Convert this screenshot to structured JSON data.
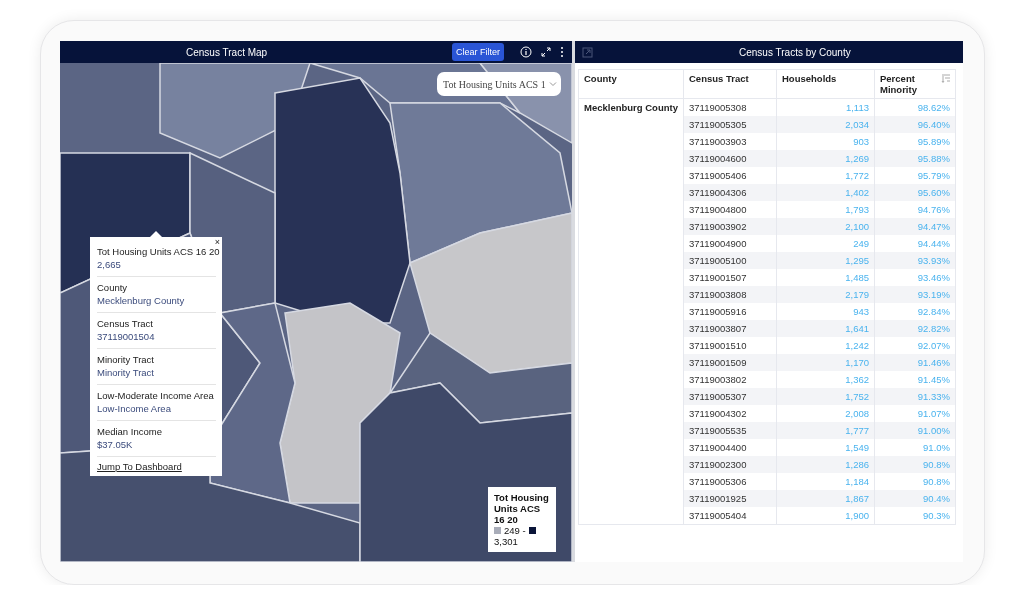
{
  "map_panel": {
    "title": "Census Tract Map",
    "clear_filter": "Clear Filter",
    "layer_select": {
      "value": "Tot Housing Units ACS 1"
    },
    "popup": {
      "close": "×",
      "fields": [
        {
          "label": "Tot Housing Units ACS 16 20",
          "value": "2,665"
        },
        {
          "label": "County",
          "value": "Mecklenburg County"
        },
        {
          "label": "Census Tract",
          "value": "37119001504"
        },
        {
          "label": "Minority Tract",
          "value": "Minority Tract"
        },
        {
          "label": "Low-Moderate Income Area",
          "value": "Low-Income Area"
        },
        {
          "label": "Median Income",
          "value": "$37.05K"
        }
      ],
      "link": "Jump To Dashboard"
    },
    "legend": {
      "title": "Tot Housing Units ACS 16 20",
      "min": "249 -",
      "max": "3,301"
    }
  },
  "table_panel": {
    "title": "Census Tracts by County",
    "columns": [
      "County",
      "Census Tract",
      "Households",
      "Percent Minority"
    ],
    "county": "Mecklenburg County",
    "rows": [
      {
        "tract": "37119005308",
        "households": "1,113",
        "percent": "98.62%"
      },
      {
        "tract": "37119005305",
        "households": "2,034",
        "percent": "96.40%"
      },
      {
        "tract": "37119003903",
        "households": "903",
        "percent": "95.89%"
      },
      {
        "tract": "37119004600",
        "households": "1,269",
        "percent": "95.88%"
      },
      {
        "tract": "37119005406",
        "households": "1,772",
        "percent": "95.79%"
      },
      {
        "tract": "37119004306",
        "households": "1,402",
        "percent": "95.60%"
      },
      {
        "tract": "37119004800",
        "households": "1,793",
        "percent": "94.76%"
      },
      {
        "tract": "37119003902",
        "households": "2,100",
        "percent": "94.47%"
      },
      {
        "tract": "37119004900",
        "households": "249",
        "percent": "94.44%"
      },
      {
        "tract": "37119005100",
        "households": "1,295",
        "percent": "93.93%"
      },
      {
        "tract": "37119001507",
        "households": "1,485",
        "percent": "93.46%"
      },
      {
        "tract": "37119003808",
        "households": "2,179",
        "percent": "93.19%"
      },
      {
        "tract": "37119005916",
        "households": "943",
        "percent": "92.84%"
      },
      {
        "tract": "37119003807",
        "households": "1,641",
        "percent": "92.82%"
      },
      {
        "tract": "37119001510",
        "households": "1,242",
        "percent": "92.07%"
      },
      {
        "tract": "37119001509",
        "households": "1,170",
        "percent": "91.46%"
      },
      {
        "tract": "37119003802",
        "households": "1,362",
        "percent": "91.45%"
      },
      {
        "tract": "37119005307",
        "households": "1,752",
        "percent": "91.33%"
      },
      {
        "tract": "37119004302",
        "households": "2,008",
        "percent": "91.07%"
      },
      {
        "tract": "37119005535",
        "households": "1,777",
        "percent": "91.00%"
      },
      {
        "tract": "37119004400",
        "households": "1,549",
        "percent": "91.0%"
      },
      {
        "tract": "37119002300",
        "households": "1,286",
        "percent": "90.8%"
      },
      {
        "tract": "37119005306",
        "households": "1,184",
        "percent": "90.8%"
      },
      {
        "tract": "37119001925",
        "households": "1,867",
        "percent": "90.4%"
      },
      {
        "tract": "37119005404",
        "households": "1,900",
        "percent": "90.3%"
      }
    ]
  }
}
